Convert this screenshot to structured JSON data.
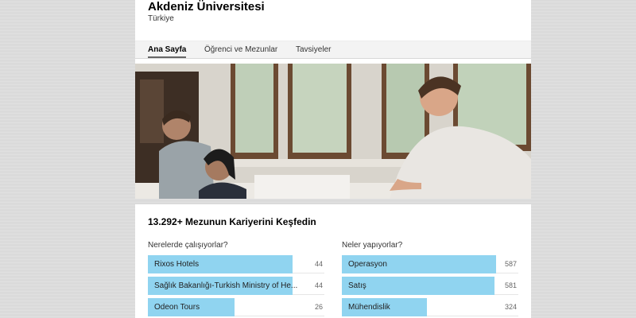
{
  "profile": {
    "name": "Akdeniz Üniversitesi",
    "country": "Türkiye"
  },
  "tabs": [
    "Ana Sayfa",
    "Öğrenci ve Mezunlar",
    "Tavsiyeler"
  ],
  "active_tab_index": 0,
  "alumni": {
    "title": "13.292+ Mezunun Kariyerini Keşfedin",
    "where": {
      "title": "Nerelerde çalışıyorlar?",
      "items": [
        {
          "label": "Rixos Hotels",
          "count": "44",
          "fraction": 0.94
        },
        {
          "label": "Sağlık Bakanlığı-Turkish Ministry of He...",
          "count": "44",
          "fraction": 0.94
        },
        {
          "label": "Odeon Tours",
          "count": "26",
          "fraction": 0.56
        }
      ]
    },
    "what": {
      "title": "Neler yapıyorlar?",
      "items": [
        {
          "label": "Operasyon",
          "count": "587",
          "fraction": 1.0
        },
        {
          "label": "Satış",
          "count": "581",
          "fraction": 0.99
        },
        {
          "label": "Mühendislik",
          "count": "324",
          "fraction": 0.55
        }
      ]
    }
  },
  "colors": {
    "bar": "#90d4f0"
  }
}
